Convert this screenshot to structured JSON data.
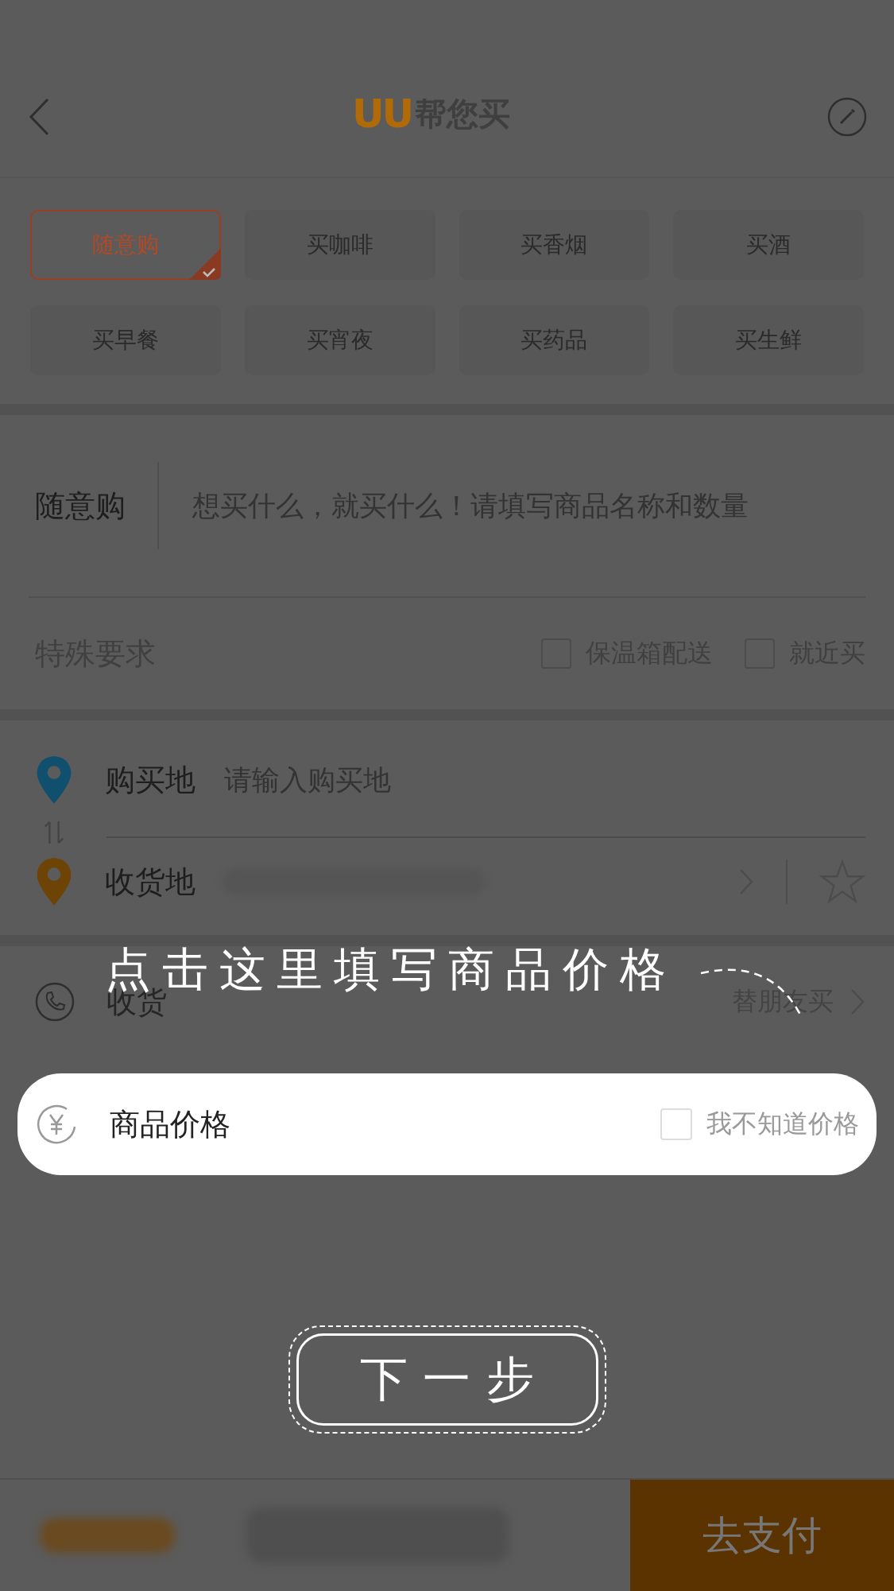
{
  "header": {
    "logo_mark": "UU",
    "logo_text": "帮您买"
  },
  "categories": [
    {
      "label": "随意购",
      "selected": true
    },
    {
      "label": "买咖啡",
      "selected": false
    },
    {
      "label": "买香烟",
      "selected": false
    },
    {
      "label": "买酒",
      "selected": false
    },
    {
      "label": "买早餐",
      "selected": false
    },
    {
      "label": "买宵夜",
      "selected": false
    },
    {
      "label": "买药品",
      "selected": false
    },
    {
      "label": "买生鲜",
      "selected": false
    }
  ],
  "order": {
    "label": "随意购",
    "placeholder": "想买什么，就买什么！请填写商品名称和数量"
  },
  "special": {
    "label": "特殊要求",
    "options": [
      {
        "label": "保温箱配送",
        "checked": false
      },
      {
        "label": "就近买",
        "checked": false
      }
    ]
  },
  "purchase_place": {
    "label": "购买地",
    "placeholder": "请输入购买地"
  },
  "delivery_place": {
    "label": "收货地"
  },
  "recipient": {
    "label": "收货",
    "action": "替朋友买"
  },
  "price": {
    "label": "商品价格",
    "unknown_label": "我不知道价格",
    "unknown_checked": false
  },
  "guide": {
    "hint": "点击这里填写商品价格",
    "next": "下 一 步"
  },
  "footer": {
    "pay": "去支付"
  }
}
